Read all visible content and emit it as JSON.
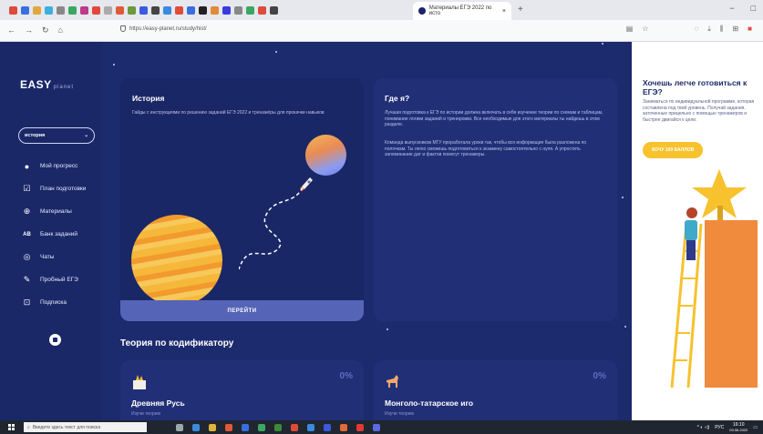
{
  "browser": {
    "tab_title": "Материалы ЕГЭ 2022 по исто",
    "new_tab": "+",
    "url": "https://easy-planet.ru/study/hist/",
    "window_controls": [
      "−",
      "□"
    ]
  },
  "sidebar": {
    "logo_main": "EASY",
    "logo_sub": "planet",
    "subject_select": "история",
    "items": [
      {
        "label": "Мой прогресс",
        "icon": "user-icon"
      },
      {
        "label": "План подготовки",
        "icon": "checkbox-icon"
      },
      {
        "label": "Материалы",
        "icon": "globe-icon"
      },
      {
        "label": "Банк заданий",
        "icon": "ab-check-icon"
      },
      {
        "label": "Чаты",
        "icon": "chat-icon"
      },
      {
        "label": "Пробный ЕГЭ",
        "icon": "pencil-icon"
      },
      {
        "label": "Подписка",
        "icon": "cart-icon"
      }
    ]
  },
  "history_card": {
    "title": "История",
    "text": "Гайды с инструкциями по решению заданий ЕГЭ 2022 и тренажёры для прокачки навыков",
    "button": "ПЕРЕЙТИ"
  },
  "where_card": {
    "title": "Где я?",
    "text1": "Лучшая подготовка к ЕГЭ по истории должна включать в себя изучение теории по схемам и таблицам, понимание логики заданий и тренировки. Все необходимые для этого материалы ты найдешь в этом разделе.",
    "text2": "Команда выпускников МГУ проработала уроки так, чтобы вся информация была разложена по полочкам. Ты легко сможешь подготовиться к экзамену самостоятельно с нуля. А упростить запоминание дат и фактов помогут тренажеры."
  },
  "promo": {
    "title": "Хочешь легче готовиться к ЕГЭ?",
    "text": "Заниматься по индивидуальной программе, которая составлена под твой уровень. Получай задания, заточенные прицельно с помощью тренажеров и быстрее двигайся к цели.",
    "button": "ХОЧУ 100 БАЛЛОВ"
  },
  "codifier": {
    "title": "Теория по кодификатору",
    "topics": [
      {
        "name": "Древняя Русь",
        "percent": "0%",
        "sub": "Изучи теорию"
      },
      {
        "name": "Монголо-татарское иго",
        "percent": "0%",
        "sub": "Изучи теорию"
      }
    ]
  },
  "taskbar": {
    "search_placeholder": "Введите здесь текст для поиска",
    "lang": "РУС",
    "time": "16:10",
    "date": "03.06.2022"
  },
  "colors": {
    "background": "#1c2a6e",
    "accent_yellow": "#f7c22e",
    "button_bar": "#5664b8"
  }
}
